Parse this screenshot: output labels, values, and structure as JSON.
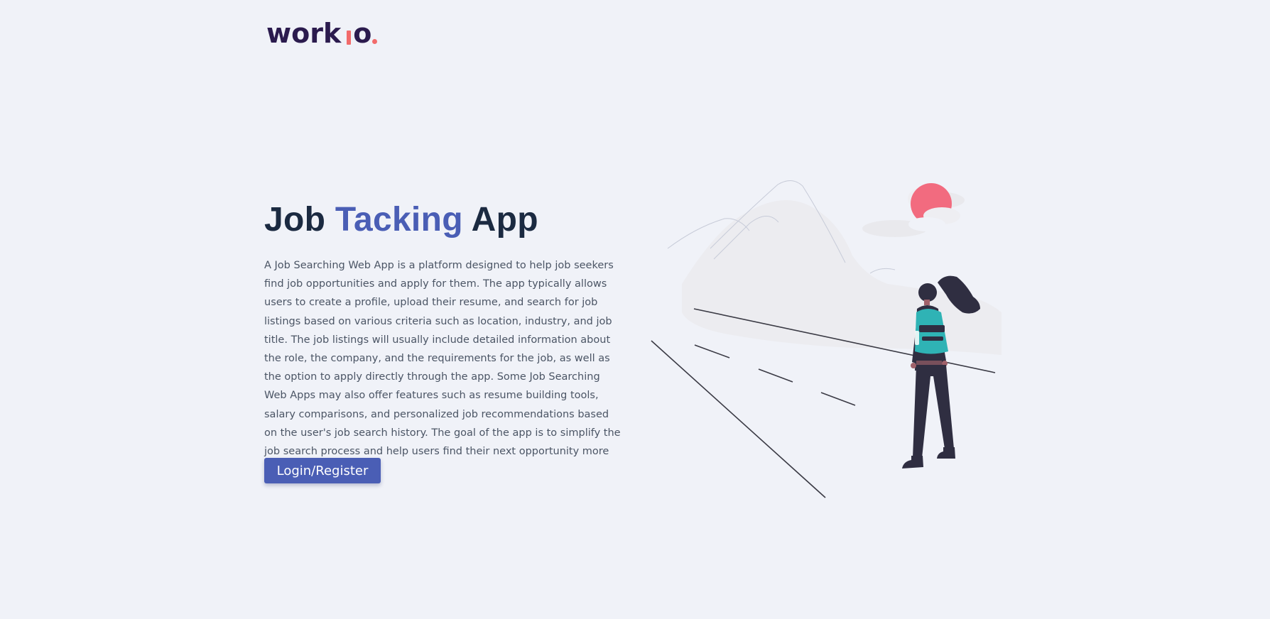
{
  "brand": {
    "logo_prefix": "work",
    "logo_suffix": "o",
    "accent_color": "#f26b6b",
    "logo_color": "#2b1b4e"
  },
  "hero": {
    "title_part1": "Job",
    "title_accent": "Tacking",
    "title_part2": "App",
    "description": "A Job Searching Web App is a platform designed to help job seekers find job opportunities and apply for them. The app typically allows users to create a profile, upload their resume, and search for job listings based on various criteria such as location, industry, and job title. The job listings will usually include detailed information about the role, the company, and the requirements for the job, as well as the option to apply directly through the app. Some Job Searching Web Apps may also offer features such as resume building tools, salary comparisons, and personalized job recommendations based on the user's job search history. The goal of the app is to simplify the job search process and help users find their next opportunity more efficiently.",
    "cta_label": "Login/Register"
  },
  "colors": {
    "background": "#f0f2f8",
    "heading": "#1b2a41",
    "primary": "#4a5eb5",
    "body_text": "#4b5565",
    "sun": "#f26b7f",
    "backpack": "#2fb3b5",
    "figure": "#2f2e41"
  }
}
